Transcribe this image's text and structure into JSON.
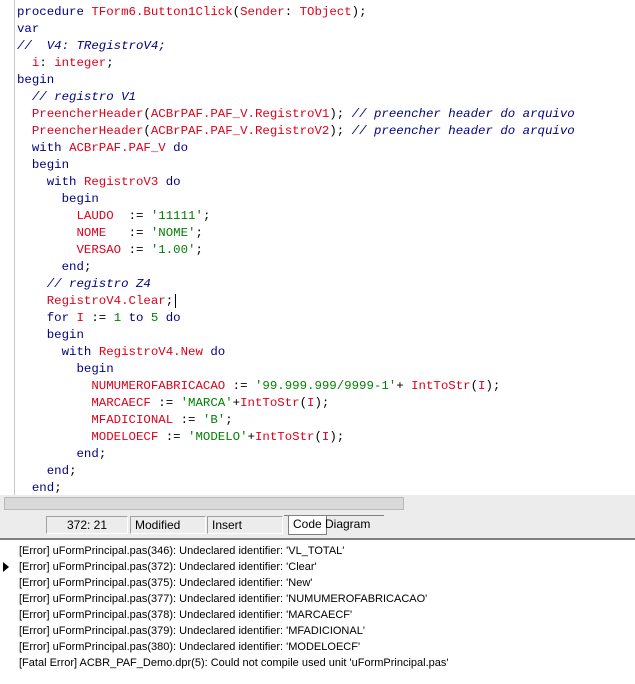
{
  "code_lines": [
    [
      [
        "kw",
        "procedure "
      ],
      [
        "id",
        "TForm6.Button1Click"
      ],
      [
        "sym",
        "("
      ],
      [
        "id",
        "Sender"
      ],
      [
        "sym",
        ": "
      ],
      [
        "id",
        "TObject"
      ],
      [
        "sym",
        ");"
      ]
    ],
    [
      [
        "kw",
        "var"
      ]
    ],
    [
      [
        "cm",
        "//  V4: TRegistroV4;"
      ]
    ],
    [
      [
        "sym",
        "  "
      ],
      [
        "id",
        "i"
      ],
      [
        "sym",
        ": "
      ],
      [
        "id",
        "integer"
      ],
      [
        "sym",
        ";"
      ]
    ],
    [
      [
        "kw",
        "begin"
      ]
    ],
    [
      [
        "sym",
        "  "
      ],
      [
        "cm",
        "// registro V1"
      ]
    ],
    [
      [
        "sym",
        "  "
      ],
      [
        "id",
        "PreencherHeader"
      ],
      [
        "sym",
        "("
      ],
      [
        "id",
        "ACBrPAF.PAF_V.RegistroV1"
      ],
      [
        "sym",
        "); "
      ],
      [
        "cm",
        "// preencher header do arquivo"
      ]
    ],
    [
      [
        "sym",
        "  "
      ],
      [
        "id",
        "PreencherHeader"
      ],
      [
        "sym",
        "("
      ],
      [
        "id",
        "ACBrPAF.PAF_V.RegistroV2"
      ],
      [
        "sym",
        "); "
      ],
      [
        "cm",
        "// preencher header do arquivo"
      ]
    ],
    [
      [
        "sym",
        "  "
      ],
      [
        "kw",
        "with "
      ],
      [
        "id",
        "ACBrPAF.PAF_V "
      ],
      [
        "kw",
        "do"
      ]
    ],
    [
      [
        "sym",
        "  "
      ],
      [
        "kw",
        "begin"
      ]
    ],
    [
      [
        "sym",
        "    "
      ],
      [
        "kw",
        "with "
      ],
      [
        "id",
        "RegistroV3 "
      ],
      [
        "kw",
        "do"
      ]
    ],
    [
      [
        "sym",
        "      "
      ],
      [
        "kw",
        "begin"
      ]
    ],
    [
      [
        "sym",
        "        "
      ],
      [
        "id",
        "LAUDO  "
      ],
      [
        "sym",
        ":= "
      ],
      [
        "str",
        "'11111'"
      ],
      [
        "sym",
        ";"
      ]
    ],
    [
      [
        "sym",
        "        "
      ],
      [
        "id",
        "NOME   "
      ],
      [
        "sym",
        ":= "
      ],
      [
        "str",
        "'NOME'"
      ],
      [
        "sym",
        ";"
      ]
    ],
    [
      [
        "sym",
        "        "
      ],
      [
        "id",
        "VERSAO "
      ],
      [
        "sym",
        ":= "
      ],
      [
        "str",
        "'1.00'"
      ],
      [
        "sym",
        ";"
      ]
    ],
    [
      [
        "sym",
        "      "
      ],
      [
        "kw",
        "end"
      ],
      [
        "sym",
        ";"
      ]
    ],
    [
      [
        "sym",
        "    "
      ],
      [
        "cm",
        "// registro Z4"
      ]
    ],
    [
      [
        "sym",
        "    "
      ],
      [
        "id",
        "RegistroV4.Clear"
      ],
      [
        "sym",
        ";"
      ]
    ],
    [
      [
        "sym",
        "    "
      ],
      [
        "kw",
        "for "
      ],
      [
        "id",
        "I "
      ],
      [
        "sym",
        ":= "
      ],
      [
        "num",
        "1 "
      ],
      [
        "kw",
        "to "
      ],
      [
        "num",
        "5 "
      ],
      [
        "kw",
        "do"
      ]
    ],
    [
      [
        "sym",
        "    "
      ],
      [
        "kw",
        "begin"
      ]
    ],
    [
      [
        "sym",
        "      "
      ],
      [
        "kw",
        "with "
      ],
      [
        "id",
        "RegistroV4.New "
      ],
      [
        "kw",
        "do"
      ]
    ],
    [
      [
        "sym",
        "        "
      ],
      [
        "kw",
        "begin"
      ]
    ],
    [
      [
        "sym",
        "          "
      ],
      [
        "id",
        "NUMUMEROFABRICACAO "
      ],
      [
        "sym",
        ":= "
      ],
      [
        "str",
        "'99.999.999/9999-1'"
      ],
      [
        "sym",
        "+ "
      ],
      [
        "id",
        "IntToStr"
      ],
      [
        "sym",
        "("
      ],
      [
        "id",
        "I"
      ],
      [
        "sym",
        ");"
      ]
    ],
    [
      [
        "sym",
        "          "
      ],
      [
        "id",
        "MARCAECF "
      ],
      [
        "sym",
        ":= "
      ],
      [
        "str",
        "'MARCA'"
      ],
      [
        "sym",
        "+"
      ],
      [
        "id",
        "IntToStr"
      ],
      [
        "sym",
        "("
      ],
      [
        "id",
        "I"
      ],
      [
        "sym",
        ");"
      ]
    ],
    [
      [
        "sym",
        "          "
      ],
      [
        "id",
        "MFADICIONAL "
      ],
      [
        "sym",
        ":= "
      ],
      [
        "str",
        "'B'"
      ],
      [
        "sym",
        ";"
      ]
    ],
    [
      [
        "sym",
        "          "
      ],
      [
        "id",
        "MODELOECF "
      ],
      [
        "sym",
        ":= "
      ],
      [
        "str",
        "'MODELO'"
      ],
      [
        "sym",
        "+"
      ],
      [
        "id",
        "IntToStr"
      ],
      [
        "sym",
        "("
      ],
      [
        "id",
        "I"
      ],
      [
        "sym",
        ");"
      ]
    ],
    [
      [
        "sym",
        "        "
      ],
      [
        "kw",
        "end"
      ],
      [
        "sym",
        ";"
      ]
    ],
    [
      [
        "sym",
        "    "
      ],
      [
        "kw",
        "end"
      ],
      [
        "sym",
        ";"
      ]
    ],
    [
      [
        "sym",
        "  "
      ],
      [
        "kw",
        "end"
      ],
      [
        "sym",
        ";"
      ]
    ]
  ],
  "statusbar": {
    "position": "372:  21",
    "modified": "Modified",
    "insert": "Insert",
    "tab_code": "Code",
    "tab_diagram": "Diagram"
  },
  "messages": [
    "[Error] uFormPrincipal.pas(346): Undeclared identifier: 'VL_TOTAL'",
    "[Error] uFormPrincipal.pas(372): Undeclared identifier: 'Clear'",
    "[Error] uFormPrincipal.pas(375): Undeclared identifier: 'New'",
    "[Error] uFormPrincipal.pas(377): Undeclared identifier: 'NUMUMEROFABRICACAO'",
    "[Error] uFormPrincipal.pas(378): Undeclared identifier: 'MARCAECF'",
    "[Error] uFormPrincipal.pas(379): Undeclared identifier: 'MFADICIONAL'",
    "[Error] uFormPrincipal.pas(380): Undeclared identifier: 'MODELOECF'",
    "[Fatal Error] ACBR_PAF_Demo.dpr(5): Could not compile used unit 'uFormPrincipal.pas'"
  ],
  "colors": {
    "keyword": "#000080",
    "identifier": "#e0001a",
    "string": "#007f00",
    "comment": "#000080"
  }
}
